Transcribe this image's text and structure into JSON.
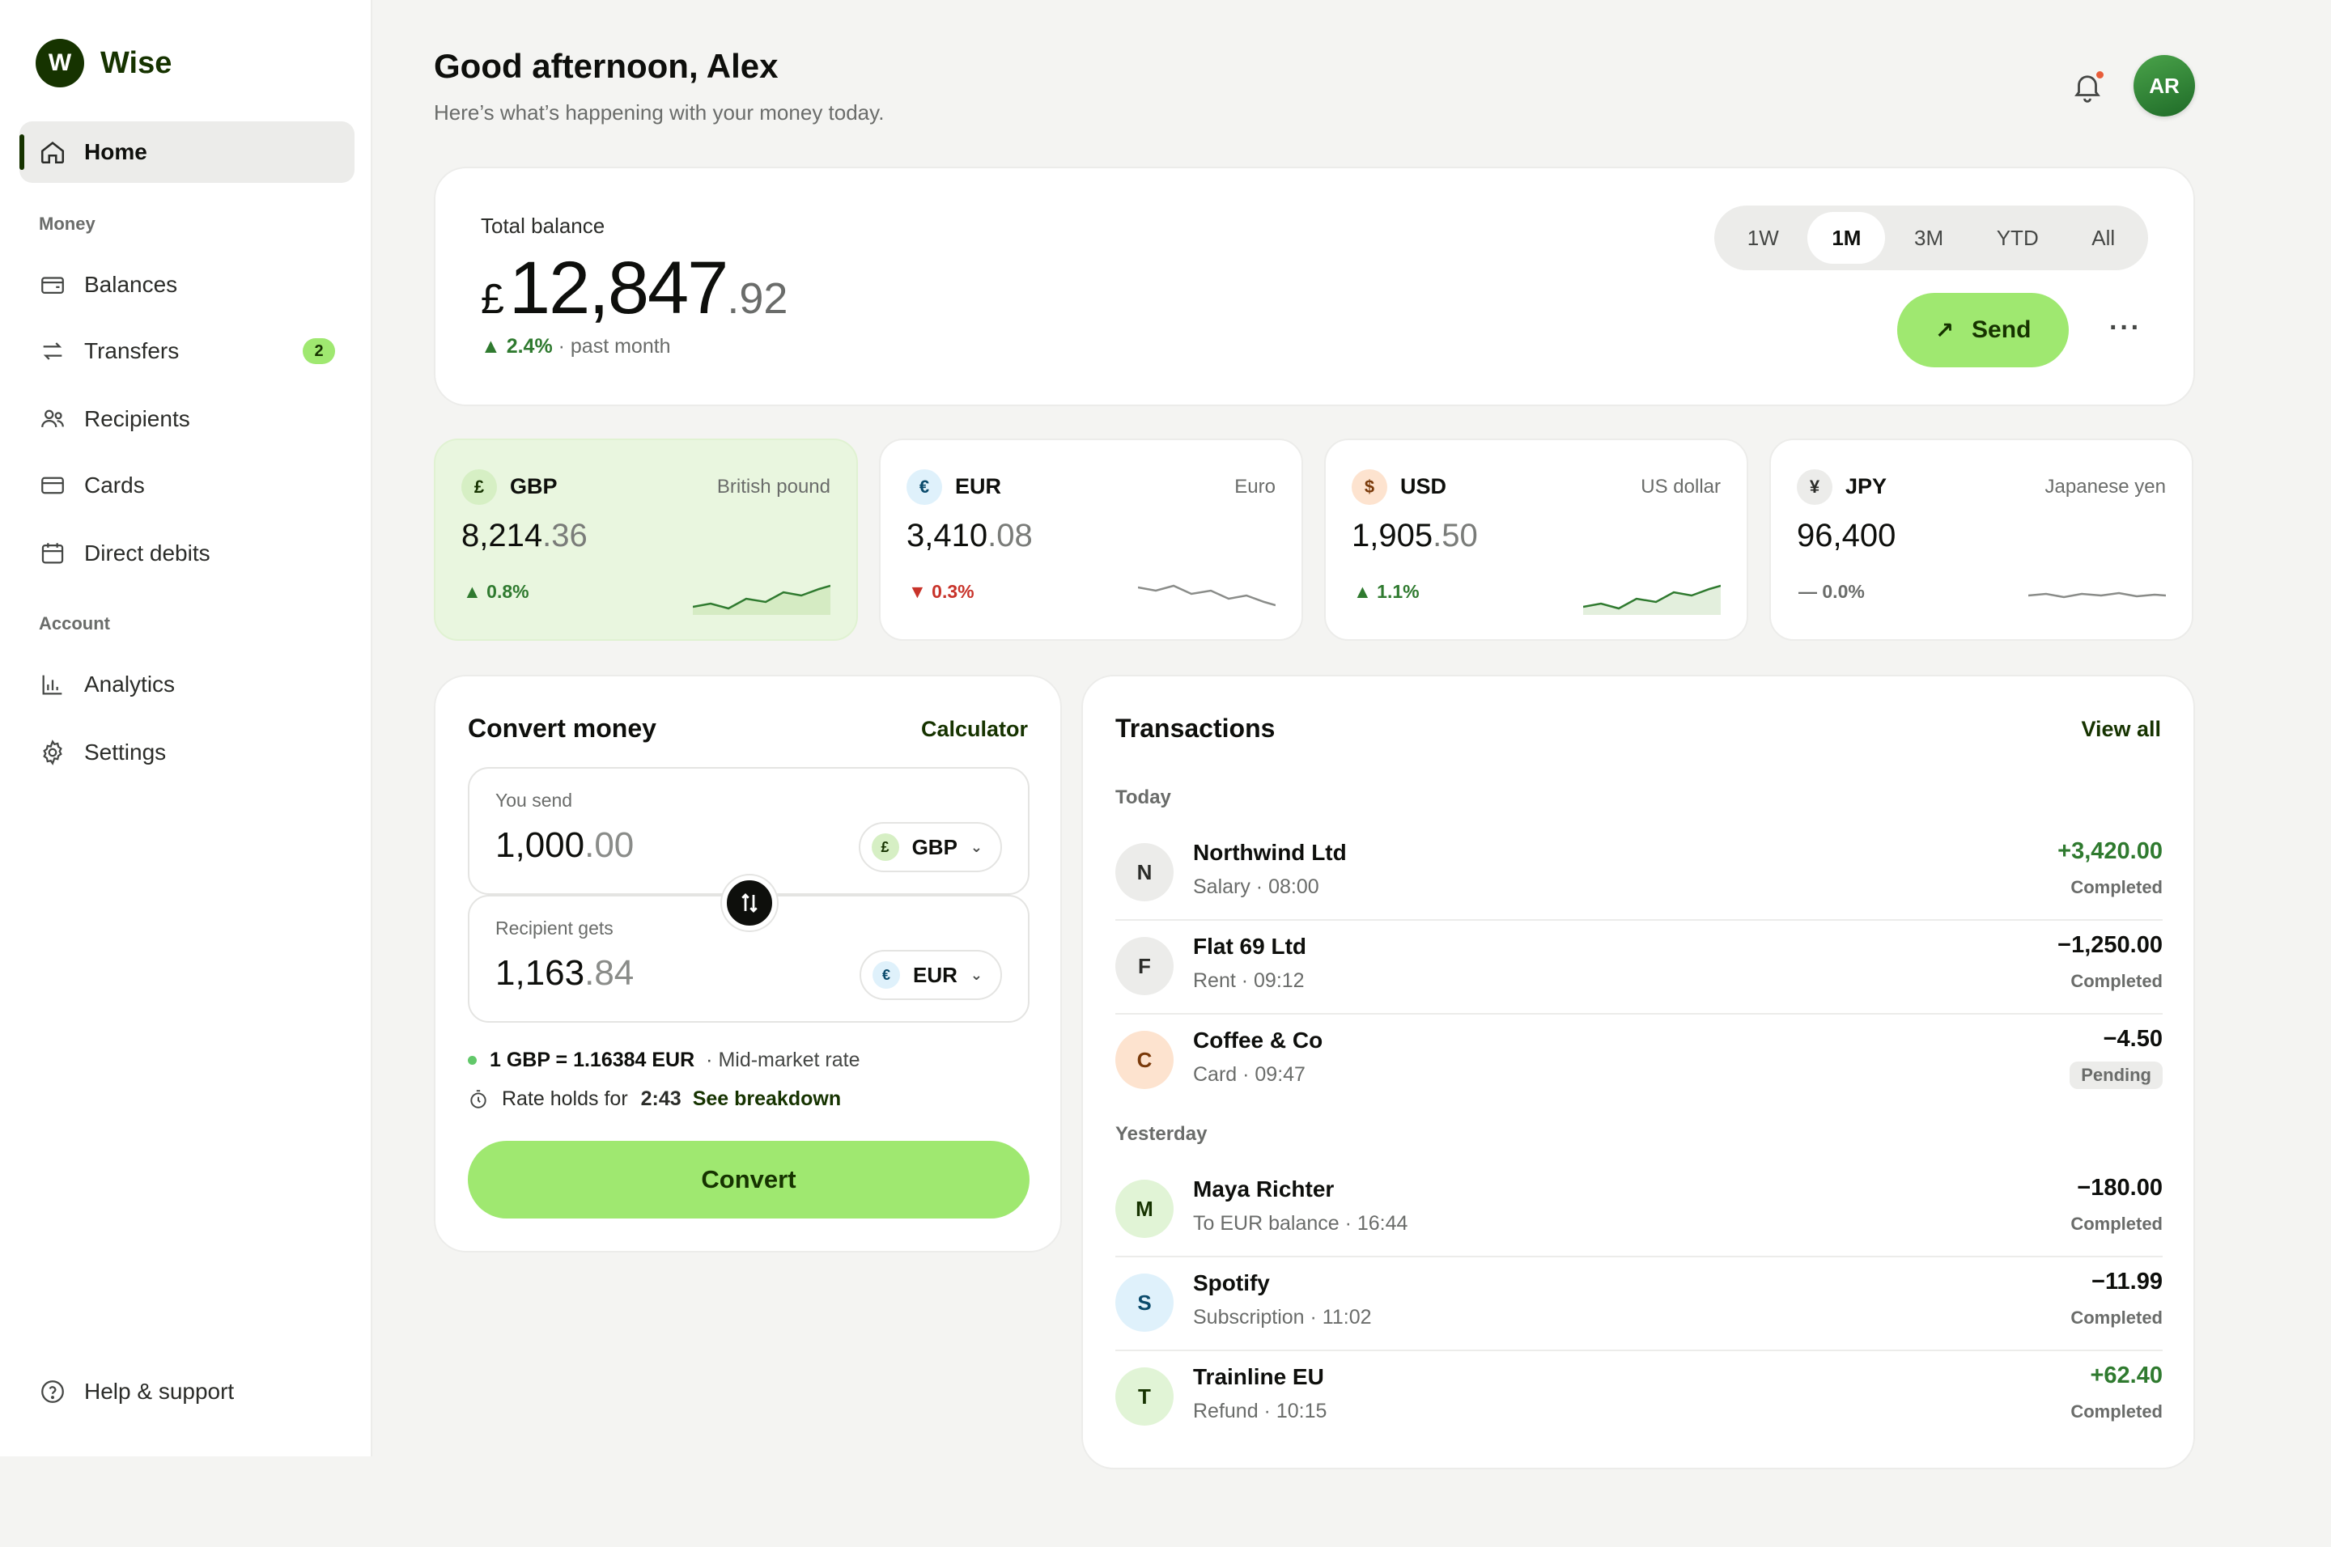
{
  "brand": {
    "logo_letter": "W",
    "name": "Wise",
    "color": "#163300",
    "accent": "#9fe870"
  },
  "sidebar": {
    "home": {
      "label": "Home",
      "icon": "home-icon"
    },
    "section_money": "Money",
    "balances": {
      "label": "Balances",
      "icon": "wallet-icon"
    },
    "transfers": {
      "label": "Transfers",
      "icon": "transfer-icon",
      "badge": "2"
    },
    "recipients": {
      "label": "Recipients",
      "icon": "users-icon"
    },
    "cards": {
      "label": "Cards",
      "icon": "card-icon"
    },
    "direct_debits": {
      "label": "Direct debits",
      "icon": "calendar-icon"
    },
    "section_account": "Account",
    "analytics": {
      "label": "Analytics",
      "icon": "chart-icon"
    },
    "settings": {
      "label": "Settings",
      "icon": "gear-icon"
    },
    "help": {
      "label": "Help & support",
      "icon": "help-icon"
    }
  },
  "header": {
    "greeting": "Good afternoon, Alex",
    "subtitle": "Here’s what’s happening with your money today.",
    "avatar_initials": "AR"
  },
  "balance": {
    "label": "Total balance",
    "currency_symbol": "£",
    "integer": "12,847",
    "decimal": ".92",
    "change": "▲ 2.4%",
    "change_suffix": "· past month",
    "periods": [
      "1W",
      "1M",
      "3M",
      "YTD",
      "All"
    ],
    "active_period": "1M",
    "send_label": "Send",
    "more_label": "···"
  },
  "currencies": [
    {
      "symbol": "£",
      "code": "GBP",
      "name": "British pound",
      "int": "8,214",
      "dec": ".36",
      "change": "▲ 0.8%",
      "trend": "up",
      "flag_bg": "#d6efc4",
      "flag_fg": "#163300"
    },
    {
      "symbol": "€",
      "code": "EUR",
      "name": "Euro",
      "int": "3,410",
      "dec": ".08",
      "change": "▼ 0.3%",
      "trend": "down",
      "flag_bg": "#dff1fb",
      "flag_fg": "#0a4a6b"
    },
    {
      "symbol": "$",
      "code": "USD",
      "name": "US dollar",
      "int": "1,905",
      "dec": ".50",
      "change": "▲ 1.1%",
      "trend": "up",
      "flag_bg": "#fde3cf",
      "flag_fg": "#7a3a0a"
    },
    {
      "symbol": "¥",
      "code": "JPY",
      "name": "Japanese yen",
      "int": "96,400",
      "dec": "",
      "change": "— 0.0%",
      "trend": "flat",
      "flag_bg": "#ececea",
      "flag_fg": "#2b2c29"
    }
  ],
  "convert": {
    "title": "Convert money",
    "calculator": "Calculator",
    "send_label": "You send",
    "send_int": "1,000",
    "send_dec": ".00",
    "send_currency": "GBP",
    "send_symbol": "£",
    "get_label": "Recipient gets",
    "get_int": "1,163",
    "get_dec": ".84",
    "get_currency": "EUR",
    "get_symbol": "€",
    "rate": "1 GBP = 1.16384 EUR",
    "rate_note": "· Mid-market rate",
    "hold_label": "Rate holds for",
    "hold_time": "2:43",
    "breakdown": "See breakdown",
    "button": "Convert"
  },
  "transactions": {
    "title": "Transactions",
    "view_all": "View all",
    "group_today": "Today",
    "group_yesterday": "Yesterday",
    "today": [
      {
        "initial": "N",
        "name": "Northwind Ltd",
        "sub": "Salary · 08:00",
        "amount": "+3,420.00",
        "status": "Completed",
        "positive": true,
        "av_bg": "#ececea",
        "av_fg": "#2b2c29"
      },
      {
        "initial": "F",
        "name": "Flat 69 Ltd",
        "sub": "Rent · 09:12",
        "amount": "−1,250.00",
        "status": "Completed",
        "positive": false,
        "av_bg": "#ececea",
        "av_fg": "#2b2c29"
      },
      {
        "initial": "C",
        "name": "Coffee & Co",
        "sub": "Card · 09:47",
        "amount": "−4.50",
        "status": "Pending",
        "positive": false,
        "av_bg": "#fde3cf",
        "av_fg": "#7a3a0a"
      }
    ],
    "yesterday": [
      {
        "initial": "M",
        "name": "Maya Richter",
        "sub": "To EUR balance · 16:44",
        "amount": "−180.00",
        "status": "Completed",
        "positive": false,
        "av_bg": "#e1f4d6",
        "av_fg": "#163300"
      },
      {
        "initial": "S",
        "name": "Spotify",
        "sub": "Subscription · 11:02",
        "amount": "−11.99",
        "status": "Completed",
        "positive": false,
        "av_bg": "#dff1fb",
        "av_fg": "#0a4a6b"
      },
      {
        "initial": "T",
        "name": "Trainline EU",
        "sub": "Refund · 10:15",
        "amount": "+62.40",
        "status": "Completed",
        "positive": true,
        "av_bg": "#e1f4d6",
        "av_fg": "#163300"
      }
    ]
  }
}
